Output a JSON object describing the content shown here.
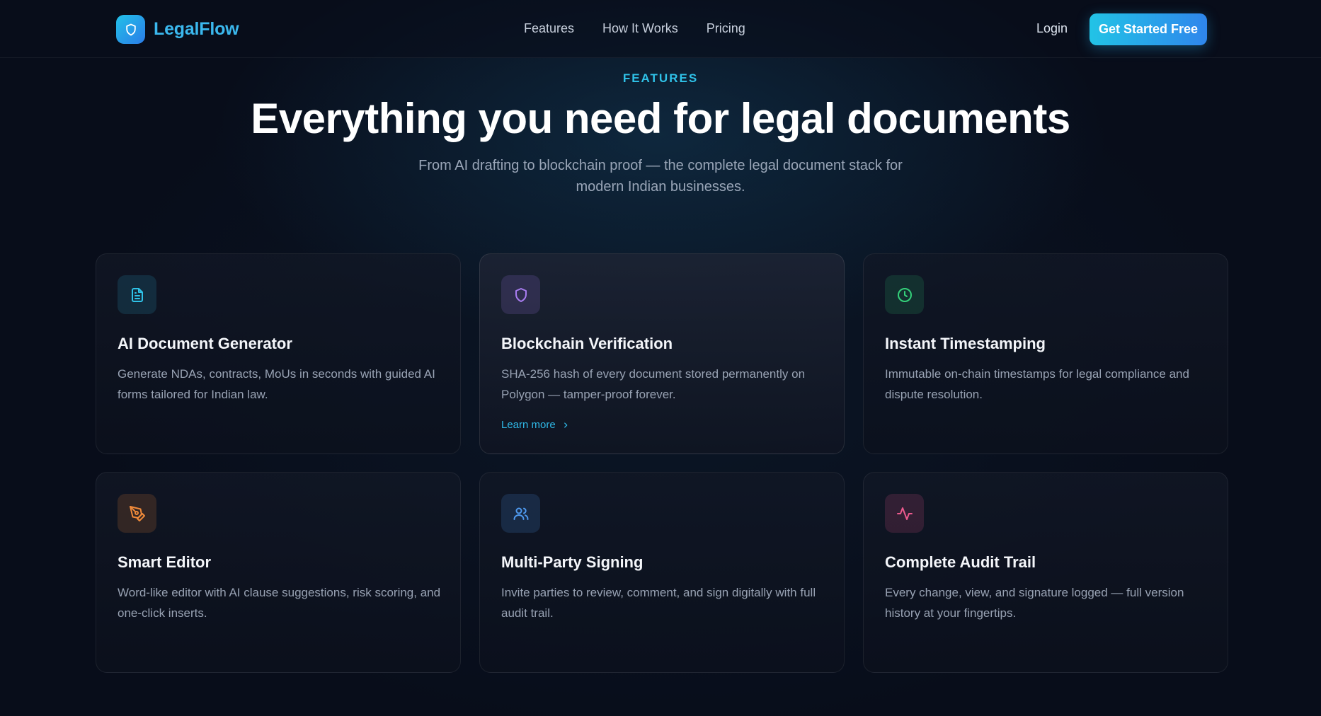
{
  "brand": {
    "name": "LegalFlow",
    "logo_icon": "shield-icon"
  },
  "nav": {
    "links": [
      "Features",
      "How It Works",
      "Pricing"
    ],
    "login_label": "Login",
    "cta_label": "Get Started Free"
  },
  "hero": {
    "eyebrow": "FEATURES",
    "title": "Everything you need for legal documents",
    "subtitle": "From AI drafting to blockchain proof — the complete legal document stack for modern Indian businesses."
  },
  "features": [
    {
      "icon": "document-icon",
      "accent": "#2fc2e8",
      "title": "AI Document Generator",
      "description": "Generate NDAs, contracts, MoUs in seconds with guided AI forms tailored for Indian law."
    },
    {
      "icon": "shield-icon",
      "accent": "#a87cf0",
      "title": "Blockchain Verification",
      "description": "SHA-256 hash of every document stored permanently on Polygon — tamper-proof forever.",
      "link_label": "Learn more"
    },
    {
      "icon": "clock-icon",
      "accent": "#34d17a",
      "title": "Instant Timestamping",
      "description": "Immutable on-chain timestamps for legal compliance and dispute resolution."
    },
    {
      "icon": "pen-tool-icon",
      "accent": "#f08a3a",
      "title": "Smart Editor",
      "description": "Word-like editor with AI clause suggestions, risk scoring, and one-click inserts."
    },
    {
      "icon": "users-icon",
      "accent": "#4f9af0",
      "title": "Multi-Party Signing",
      "description": "Invite parties to review, comment, and sign digitally with full audit trail."
    },
    {
      "icon": "activity-icon",
      "accent": "#ec5a8e",
      "title": "Complete Audit Trail",
      "description": "Every change, view, and signature logged — full version history at your fingertips."
    }
  ],
  "colors": {
    "background": "#080d1a",
    "brand": "#3bb8ee",
    "cta_gradient_start": "#22c3e6",
    "cta_gradient_end": "#2f86ec"
  }
}
